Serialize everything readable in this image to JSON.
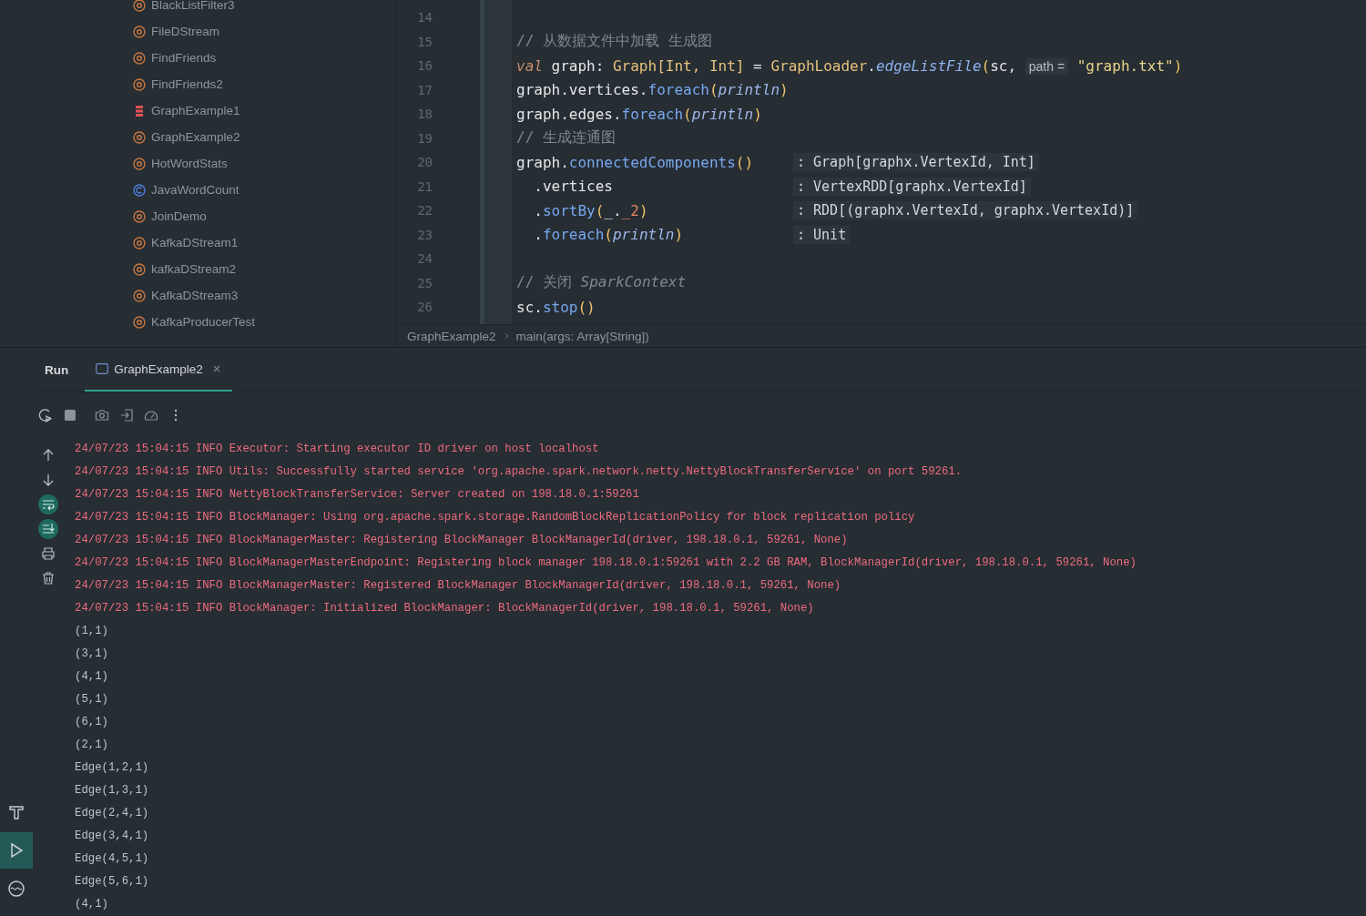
{
  "project_tree": {
    "items": [
      {
        "label": "BlackListFilter3",
        "kind": "object"
      },
      {
        "label": "FileDStream",
        "kind": "object"
      },
      {
        "label": "FindFriends",
        "kind": "object"
      },
      {
        "label": "FindFriends2",
        "kind": "object"
      },
      {
        "label": "GraphExample1",
        "kind": "scala"
      },
      {
        "label": "GraphExample2",
        "kind": "object"
      },
      {
        "label": "HotWordStats",
        "kind": "object"
      },
      {
        "label": "JavaWordCount",
        "kind": "class"
      },
      {
        "label": "JoinDemo",
        "kind": "object"
      },
      {
        "label": "KafkaDStream1",
        "kind": "object"
      },
      {
        "label": "kafkaDStream2",
        "kind": "object"
      },
      {
        "label": "KafkaDStream3",
        "kind": "object"
      },
      {
        "label": "KafkaProducerTest",
        "kind": "object"
      }
    ]
  },
  "editor": {
    "lines": [
      {
        "number": "14"
      },
      {
        "number": "15",
        "tokens": [
          {
            "text": "// 从数据文件中加载 生成图",
            "kind": "comment"
          }
        ]
      },
      {
        "number": "16",
        "tokens": [
          {
            "text": "val",
            "kind": "keyword"
          },
          {
            "text": " graph: ",
            "kind": "plain"
          },
          {
            "text": "Graph[Int, Int]",
            "kind": "type"
          },
          {
            "text": " = ",
            "kind": "plain"
          },
          {
            "text": "GraphLoader",
            "kind": "type"
          },
          {
            "text": ".",
            "kind": "plain"
          },
          {
            "text": "edgeListFile",
            "kind": "static"
          },
          {
            "text": "(",
            "kind": "paren"
          },
          {
            "text": "sc, ",
            "kind": "plain"
          },
          {
            "text": "path =",
            "kind": "hint"
          },
          {
            "text": " \"graph.txt\"",
            "kind": "string"
          },
          {
            "text": ")",
            "kind": "paren"
          }
        ]
      },
      {
        "number": "17",
        "tokens": [
          {
            "text": "graph.",
            "kind": "plain"
          },
          {
            "text": "vertices",
            "kind": "field"
          },
          {
            "text": ".",
            "kind": "plain"
          },
          {
            "text": "foreach",
            "kind": "method"
          },
          {
            "text": "(",
            "kind": "paren"
          },
          {
            "text": "println",
            "kind": "fn"
          },
          {
            "text": ")",
            "kind": "paren"
          }
        ]
      },
      {
        "number": "18",
        "tokens": [
          {
            "text": "graph.",
            "kind": "plain"
          },
          {
            "text": "edges",
            "kind": "field"
          },
          {
            "text": ".",
            "kind": "plain"
          },
          {
            "text": "foreach",
            "kind": "method"
          },
          {
            "text": "(",
            "kind": "paren"
          },
          {
            "text": "println",
            "kind": "fn"
          },
          {
            "text": ")",
            "kind": "paren"
          }
        ]
      },
      {
        "number": "19",
        "tokens": [
          {
            "text": "// 生成连通图",
            "kind": "comment"
          }
        ]
      },
      {
        "number": "20",
        "tokens": [
          {
            "text": "graph.",
            "kind": "plain"
          },
          {
            "text": "connectedComponents",
            "kind": "method"
          },
          {
            "text": "()",
            "kind": "paren"
          }
        ],
        "type_hint": ": Graph[graphx.VertexId, Int]"
      },
      {
        "number": "21",
        "tokens": [
          {
            "text": "  .vertices",
            "kind": "plain"
          }
        ],
        "type_hint": ": VertexRDD[graphx.VertexId]"
      },
      {
        "number": "22",
        "tokens": [
          {
            "text": "  .",
            "kind": "plain"
          },
          {
            "text": "sortBy",
            "kind": "method"
          },
          {
            "text": "(",
            "kind": "paren"
          },
          {
            "text": "_.",
            "kind": "plain"
          },
          {
            "text": "_2",
            "kind": "number"
          },
          {
            "text": ")",
            "kind": "paren"
          }
        ],
        "type_hint": ": RDD[(graphx.VertexId, graphx.VertexId)]"
      },
      {
        "number": "23",
        "tokens": [
          {
            "text": "  .",
            "kind": "plain"
          },
          {
            "text": "foreach",
            "kind": "method"
          },
          {
            "text": "(",
            "kind": "paren"
          },
          {
            "text": "println",
            "kind": "fn"
          },
          {
            "text": ")",
            "kind": "paren"
          }
        ],
        "type_hint": ": Unit"
      },
      {
        "number": "24"
      },
      {
        "number": "25",
        "tokens": [
          {
            "text": "// 关闭 ",
            "kind": "comment"
          },
          {
            "text": "SparkContext",
            "kind": "comment_italic"
          }
        ]
      },
      {
        "number": "26",
        "tokens": [
          {
            "text": "sc.",
            "kind": "plain"
          },
          {
            "text": "stop",
            "kind": "method"
          },
          {
            "text": "()",
            "kind": "paren"
          }
        ]
      }
    ],
    "breadcrumbs": [
      "GraphExample2",
      "main(args: Array[String])"
    ]
  },
  "run_panel": {
    "title": "Run",
    "tabs": [
      {
        "label": "GraphExample2",
        "selected": true
      }
    ],
    "side_toggles": [
      {
        "kind": "up",
        "on": false
      },
      {
        "kind": "down",
        "on": false
      },
      {
        "kind": "wrap",
        "on": true
      },
      {
        "kind": "scroll-end",
        "on": true
      },
      {
        "kind": "print",
        "on": false
      },
      {
        "kind": "trash",
        "on": false
      }
    ],
    "console": [
      {
        "kind": "log",
        "text": "24/07/23 15:04:15 INFO Executor: Starting executor ID driver on host localhost"
      },
      {
        "kind": "log",
        "text": "24/07/23 15:04:15 INFO Utils: Successfully started service 'org.apache.spark.network.netty.NettyBlockTransferService' on port 59261."
      },
      {
        "kind": "log",
        "text": "24/07/23 15:04:15 INFO NettyBlockTransferService: Server created on 198.18.0.1:59261"
      },
      {
        "kind": "log",
        "text": "24/07/23 15:04:15 INFO BlockManager: Using org.apache.spark.storage.RandomBlockReplicationPolicy for block replication policy"
      },
      {
        "kind": "log",
        "text": "24/07/23 15:04:15 INFO BlockManagerMaster: Registering BlockManager BlockManagerId(driver, 198.18.0.1, 59261, None)"
      },
      {
        "kind": "log",
        "text": "24/07/23 15:04:15 INFO BlockManagerMasterEndpoint: Registering block manager 198.18.0.1:59261 with 2.2 GB RAM, BlockManagerId(driver, 198.18.0.1, 59261, None)"
      },
      {
        "kind": "log",
        "text": "24/07/23 15:04:15 INFO BlockManagerMaster: Registered BlockManager BlockManagerId(driver, 198.18.0.1, 59261, None)"
      },
      {
        "kind": "log",
        "text": "24/07/23 15:04:15 INFO BlockManager: Initialized BlockManager: BlockManagerId(driver, 198.18.0.1, 59261, None)"
      },
      {
        "kind": "out",
        "text": "(1,1)"
      },
      {
        "kind": "out",
        "text": "(3,1)"
      },
      {
        "kind": "out",
        "text": "(4,1)"
      },
      {
        "kind": "out",
        "text": "(5,1)"
      },
      {
        "kind": "out",
        "text": "(6,1)"
      },
      {
        "kind": "out",
        "text": "(2,1)"
      },
      {
        "kind": "out",
        "text": "Edge(1,2,1)"
      },
      {
        "kind": "out",
        "text": "Edge(1,3,1)"
      },
      {
        "kind": "out",
        "text": "Edge(2,4,1)"
      },
      {
        "kind": "out",
        "text": "Edge(3,4,1)"
      },
      {
        "kind": "out",
        "text": "Edge(4,5,1)"
      },
      {
        "kind": "out",
        "text": "Edge(5,6,1)"
      },
      {
        "kind": "out",
        "text": "(4,1)"
      }
    ]
  },
  "tool_strip": [
    {
      "kind": "build",
      "selected": false
    },
    {
      "kind": "run",
      "selected": true
    },
    {
      "kind": "services",
      "selected": false
    }
  ]
}
